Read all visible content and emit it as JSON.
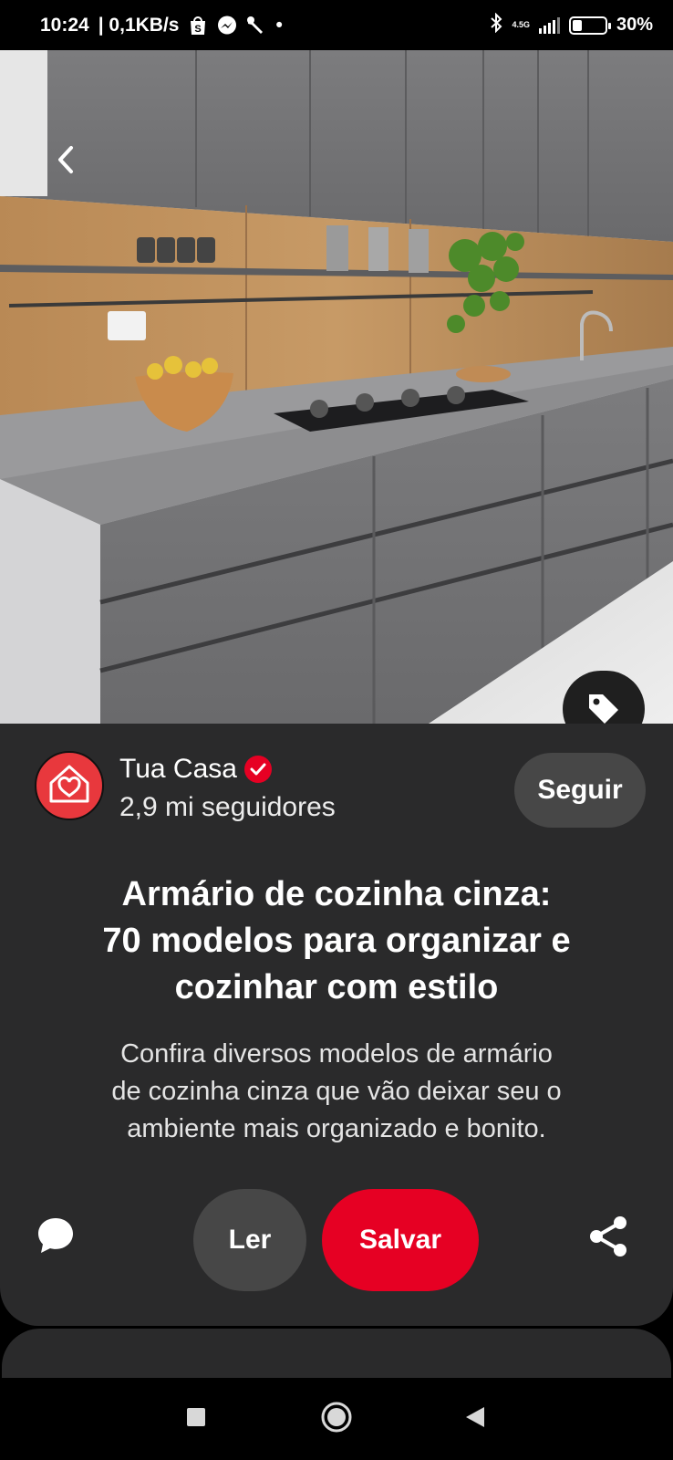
{
  "status_bar": {
    "time": "10:24",
    "network_speed": "| 0,1KB/s",
    "dot": "•",
    "network_type": "4.5G",
    "battery": "30%",
    "battery_level": 0.3,
    "icons": [
      "shopee-icon",
      "messenger-icon",
      "wrench-icon",
      "bluetooth-icon",
      "signal-icon",
      "battery-icon"
    ]
  },
  "hero": {
    "back_icon": "chevron-left-icon",
    "tag_icon": "tag-icon"
  },
  "profile": {
    "name": "Tua Casa",
    "verified": true,
    "followers": "2,9 mi seguidores",
    "follow_label": "Seguir"
  },
  "pin": {
    "title_line1": "Armário de cozinha cinza:",
    "title_line2": "70 modelos para organizar e",
    "title_line3": "cozinhar com estilo",
    "desc_line1": "Confira diversos modelos de armário",
    "desc_line2": "de cozinha cinza que vão deixar seu o",
    "desc_line3": "ambiente mais organizado e bonito."
  },
  "actions": {
    "read_label": "Ler",
    "save_label": "Salvar",
    "comment_icon": "comment-icon",
    "share_icon": "share-icon"
  },
  "colors": {
    "accent": "#e60023",
    "sheet_bg": "#2a2a2b",
    "button_gray": "#474747",
    "avatar_red": "#e8383d"
  },
  "nav": [
    "recents-square-icon",
    "home-circle-icon",
    "back-triangle-icon"
  ]
}
